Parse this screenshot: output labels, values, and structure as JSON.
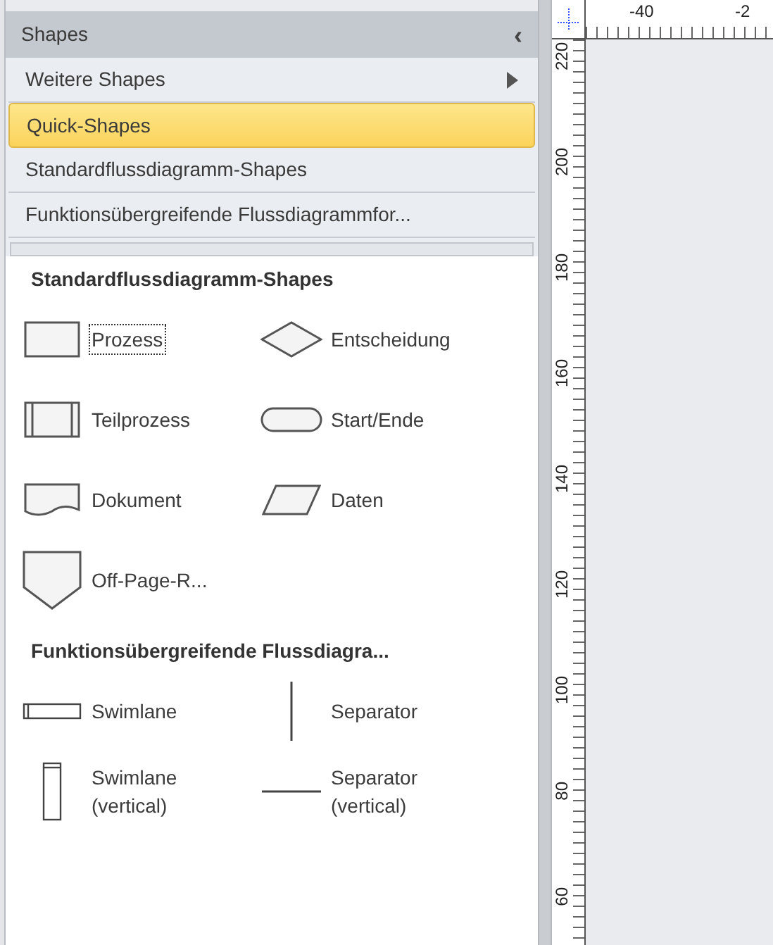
{
  "panel": {
    "title": "Shapes",
    "collapse_glyph": "‹"
  },
  "stencils": [
    {
      "label": "Weitere Shapes",
      "selected": false,
      "submenu": true
    },
    {
      "label": "Quick-Shapes",
      "selected": true,
      "submenu": false
    },
    {
      "label": "Standardflussdiagramm-Shapes",
      "selected": false,
      "submenu": false
    },
    {
      "label": "Funktionsübergreifende Flussdiagrammfor...",
      "selected": false,
      "submenu": false
    }
  ],
  "sections": [
    {
      "title": "Standardflussdiagramm-Shapes",
      "shapes": [
        {
          "kind": "process",
          "label": "Prozess",
          "focused": true
        },
        {
          "kind": "decision",
          "label": "Entscheidung",
          "focused": false
        },
        {
          "kind": "subprocess",
          "label": "Teilprozess",
          "focused": false
        },
        {
          "kind": "terminator",
          "label": "Start/Ende",
          "focused": false
        },
        {
          "kind": "document",
          "label": "Dokument",
          "focused": false
        },
        {
          "kind": "data",
          "label": "Daten",
          "focused": false
        },
        {
          "kind": "offpage",
          "label": "Off-Page-R...",
          "focused": false
        }
      ]
    },
    {
      "title": "Funktionsübergreifende Flussdiagra...",
      "shapes": [
        {
          "kind": "swimlane",
          "label": "Swimlane",
          "focused": false
        },
        {
          "kind": "vseparator",
          "label": "Separator",
          "focused": false
        },
        {
          "kind": "vswimlane",
          "label": "Swimlane (vertical)",
          "focused": false
        },
        {
          "kind": "hseparator",
          "label": "Separator (vertical)",
          "focused": false
        }
      ]
    }
  ],
  "ruler": {
    "top_labels": [
      "-40",
      "-2"
    ],
    "side_labels": [
      "220",
      "200",
      "180",
      "160",
      "140",
      "120",
      "100",
      "80",
      "60"
    ]
  }
}
